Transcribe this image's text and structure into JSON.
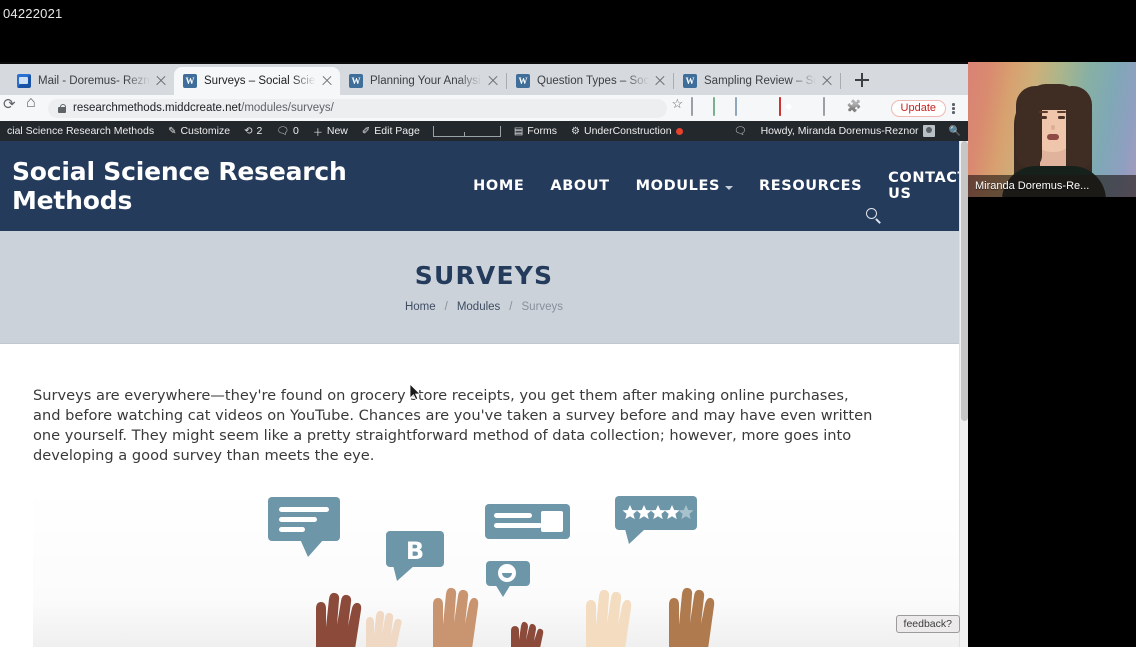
{
  "recording": {
    "label": "04222021"
  },
  "browser": {
    "tabs": [
      {
        "title": "Mail - Doremus- Reznor, Mirar",
        "icon": "outlook-icon",
        "active": false
      },
      {
        "title": "Surveys – Social Science Rese",
        "icon": "wordpress-icon",
        "active": true
      },
      {
        "title": "Planning Your Analysis – Socia",
        "icon": "wordpress-icon",
        "active": false
      },
      {
        "title": "Question Types – Social Scien",
        "icon": "wordpress-icon",
        "active": false
      },
      {
        "title": "Sampling Review – Social Scie",
        "icon": "wordpress-icon",
        "active": false
      }
    ],
    "new_tab_label": "+",
    "url_host": "researchmethods.middcreate.net",
    "url_path": "/modules/surveys/",
    "update_button": "Update",
    "toolbar_icons": [
      "reload-icon",
      "home-icon",
      "lock-icon",
      "bookmark-star-icon",
      "extension-icon-1",
      "extension-icon-2",
      "extension-icon-3",
      "extension-icon-4",
      "extension-icon-5",
      "extension-icon-6",
      "extension-icon-7",
      "puzzle-extensions-icon",
      "profile-avatar-icon",
      "chrome-menu-icon"
    ]
  },
  "adminbar": {
    "site_name": "cial Science Research Methods",
    "customize": "Customize",
    "revisions_count": "2",
    "comments_count": "0",
    "new": "New",
    "edit_page": "Edit Page",
    "forms": "Forms",
    "under_construction": "UnderConstruction",
    "howdy": "Howdy, Miranda Doremus-Reznor"
  },
  "site": {
    "brand": "Social Science Research Methods",
    "nav": [
      {
        "label": "HOME",
        "caret": false
      },
      {
        "label": "ABOUT",
        "caret": false
      },
      {
        "label": "MODULES",
        "caret": true
      },
      {
        "label": "RESOURCES",
        "caret": false
      },
      {
        "label": "CONTACT US",
        "caret": false
      }
    ],
    "header_bg": "#243b5c"
  },
  "hero": {
    "title": "SURVEYS",
    "breadcrumbs": [
      {
        "label": "Home",
        "current": false
      },
      {
        "label": "Modules",
        "current": false
      },
      {
        "label": "Surveys",
        "current": true
      }
    ],
    "separator": "/",
    "bg": "#ccd2da"
  },
  "content": {
    "intro": "Surveys are everywhere—they're found on grocery store receipts, you get them after making online purchases, and before watching cat videos on YouTube. Chances are you've taken a survey before and may have even written one yourself. They might seem like a pretty straightforward method of data collection; however, more goes into developing a good survey than meets the eye.",
    "illustration": {
      "name": "hands-and-speech-bubbles-illustration",
      "bubble_letter": "B",
      "stars_filled": 4,
      "stars_total": 5,
      "accent": "#6d96a8"
    }
  },
  "feedback": {
    "label": "feedback?"
  },
  "video": {
    "participant_name": "Miranda Doremus-Re...",
    "background": "rainbow-gradient"
  }
}
